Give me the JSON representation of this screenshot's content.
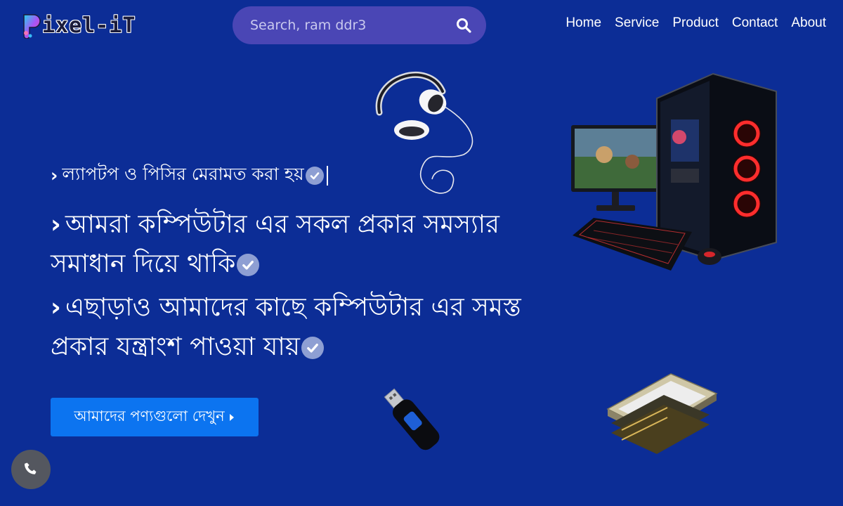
{
  "header": {
    "logo_text": "ixel-iT",
    "search_placeholder": "Search, ram ddr3",
    "nav": [
      "Home",
      "Service",
      "Product",
      "Contact",
      "About"
    ]
  },
  "hero": {
    "line1": "ল্যাপটপ ও পিসির মেরামত করা হয়",
    "line2": "আমরা কম্পিউটার এর সকল প্রকার সমস্যার সমাধান দিয়ে থাকি",
    "line3": "এছাড়াও আমাদের কাছে কম্পিউটার এর সমস্ত প্রকার যন্ত্রাংশ পাওয়া যায়",
    "cta_label": "আমাদের পণ্যগুলো দেখুন"
  },
  "colors": {
    "background": "#0c2d96",
    "search_bg": "#4a46b5",
    "cta": "#0c74f0",
    "check_bg": "#8e9fd3",
    "phone_bg": "#54575f"
  },
  "icons": [
    "search-icon",
    "check-icon",
    "chevron-right-icon",
    "caret-right-icon",
    "phone-icon",
    "headphones-image",
    "gaming-pc-image",
    "usb-drive-image",
    "ssd-image"
  ]
}
